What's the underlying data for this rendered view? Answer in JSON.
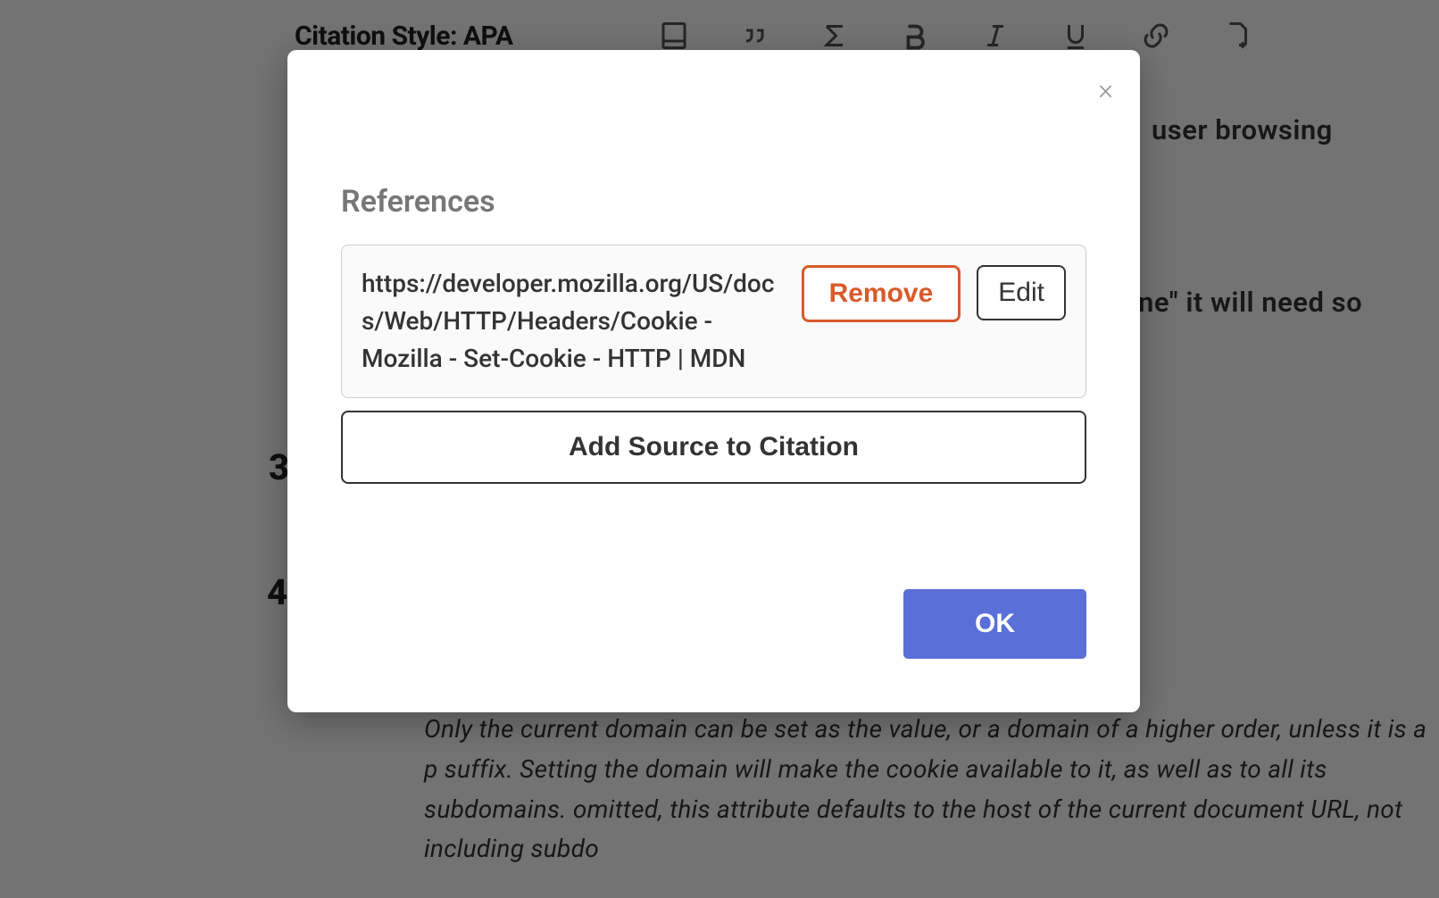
{
  "toolbar": {
    "citation_style_label": "Citation Style: APA"
  },
  "background": {
    "text_fragment_1": "user browsing",
    "text_fragment_2": "ne\" it will need so",
    "list_number_3": "3",
    "list_number_4": "4",
    "paragraph": "Only the current domain can be set as the value, or a domain of a higher order, unless it is a p suffix. Setting the domain will make the cookie available to it, as well as to all its subdomains. omitted, this attribute defaults to the host of the current document URL, not including subdo"
  },
  "modal": {
    "close_glyph": "×",
    "title": "References",
    "reference": {
      "text": "https://developer.mozilla.org/US/docs/Web/HTTP/Headers/Cookie - Mozilla - Set-Cookie - HTTP | MDN"
    },
    "remove_label": "Remove",
    "edit_label": "Edit",
    "add_source_label": "Add Source to Citation",
    "ok_label": "OK"
  }
}
